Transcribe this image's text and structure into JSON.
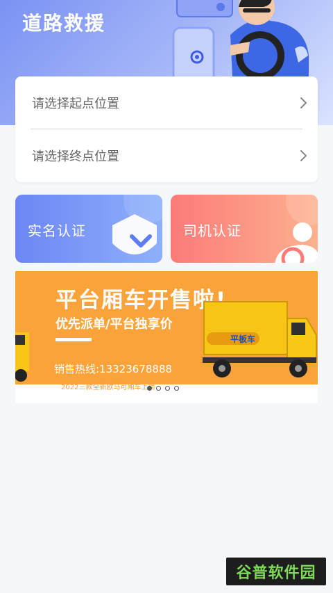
{
  "header": {
    "title": "道路救援"
  },
  "route": {
    "start_label": "请选择起点位置",
    "end_label": "请选择终点位置"
  },
  "auth": {
    "real_name_label": "实名认证",
    "driver_label": "司机认证"
  },
  "banner": {
    "headline": "平台厢车开售啦!",
    "subline": "优先派单/平台独享价",
    "hotline": "销售热线:13323678888",
    "footnote": "2022三款全新欧马可厢车上简",
    "truck_text": "平板车",
    "page_count": 4,
    "active_page": 1
  },
  "watermark": {
    "text": "谷普软件园"
  },
  "colors": {
    "hero": "#7a92f3",
    "real_name_card": "#6d86f4",
    "driver_card": "#fb7b79",
    "banner_orange": "#f9a33a",
    "truck_yellow": "#f6c515"
  }
}
